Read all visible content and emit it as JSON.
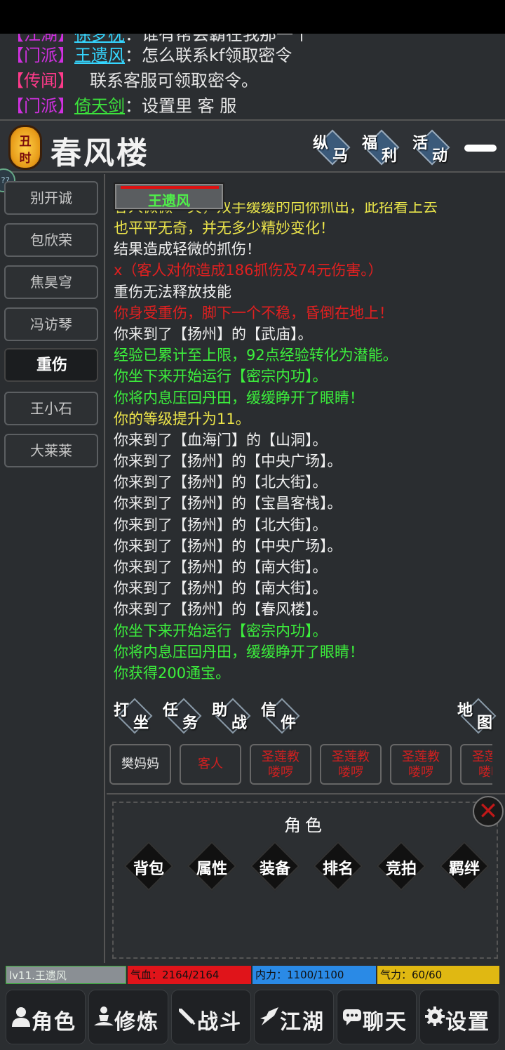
{
  "chat": {
    "lines": [
      {
        "tag": "【江湖】",
        "name": "徐梦枕",
        "text": "：谁有帮会霸在我那一个"
      },
      {
        "tag": "【门派】",
        "name": "王遗风",
        "text": "：怎么联系kf领取密令"
      },
      {
        "tag": "【传闻】",
        "name": "",
        "text": "联系客服可领取密令。"
      },
      {
        "tag": "【门派】",
        "name": "倚天剑",
        "text": "：设置里 客 服"
      }
    ]
  },
  "header": {
    "time_top": "丑",
    "time_bottom": "时",
    "location": "春风楼",
    "buttons": [
      {
        "c1": "纵",
        "c2": "马"
      },
      {
        "c1": "福",
        "c2": "利"
      },
      {
        "c1": "活",
        "c2": "动"
      }
    ]
  },
  "sidebar": {
    "help": "??",
    "npcs": [
      "别开诚",
      "包欣荣",
      "焦昊穹",
      "冯访琴",
      "",
      "王小石",
      "大莱莱"
    ],
    "status_popup": "重伤"
  },
  "target": {
    "name": "王遗风"
  },
  "log": {
    "clipped": "客人微微一笑，双手缓缓的向你抓出，此招看上去",
    "lines": [
      {
        "text": "也平平无奇，并无多少精妙变化！",
        "color": "yellow"
      },
      {
        "text": "结果造成轻微的抓伤！",
        "color": "white"
      },
      {
        "text": "x（客人对你造成186抓伤及74元伤害。）",
        "color": "red"
      },
      {
        "text": "重伤无法释放技能",
        "color": "white"
      },
      {
        "text": "你身受重伤，脚下一个不稳，昏倒在地上！",
        "color": "red"
      },
      {
        "text": "你来到了【扬州】的【武庙】。",
        "color": "white"
      },
      {
        "text": "经验已累计至上限，92点经验转化为潜能。",
        "color": "green"
      },
      {
        "text": "你坐下来开始运行【密宗内功】。",
        "color": "green"
      },
      {
        "text": "你将内息压回丹田，缓缓睁开了眼睛！",
        "color": "green"
      },
      {
        "text": "你的等级提升为11。",
        "color": "yellow"
      },
      {
        "text": "你来到了【血海门】的【山洞】。",
        "color": "white"
      },
      {
        "text": "你来到了【扬州】的【中央广场】。",
        "color": "white"
      },
      {
        "text": "你来到了【扬州】的【北大街】。",
        "color": "white"
      },
      {
        "text": "你来到了【扬州】的【宝昌客栈】。",
        "color": "white"
      },
      {
        "text": "你来到了【扬州】的【北大街】。",
        "color": "white"
      },
      {
        "text": "你来到了【扬州】的【中央广场】。",
        "color": "white"
      },
      {
        "text": "你来到了【扬州】的【南大街】。",
        "color": "white"
      },
      {
        "text": "你来到了【扬州】的【南大街】。",
        "color": "white"
      },
      {
        "text": "你来到了【扬州】的【春风楼】。",
        "color": "white"
      },
      {
        "text": "你坐下来开始运行【密宗内功】。",
        "color": "green"
      },
      {
        "text": "你将内息压回丹田，缓缓睁开了眼睛！",
        "color": "green"
      },
      {
        "text": "你获得200通宝。",
        "color": "green"
      }
    ]
  },
  "actions": [
    {
      "c1": "打",
      "c2": "坐"
    },
    {
      "c1": "任",
      "c2": "务"
    },
    {
      "c1": "助",
      "c2": "战"
    },
    {
      "c1": "信",
      "c2": "件"
    },
    {
      "c1": "地",
      "c2": "图"
    }
  ],
  "people": [
    {
      "l1": "樊妈妈",
      "l2": "",
      "color": "white"
    },
    {
      "l1": "客人",
      "l2": "",
      "color": "red"
    },
    {
      "l1": "圣莲教",
      "l2": "喽啰",
      "color": "red"
    },
    {
      "l1": "圣莲教",
      "l2": "喽啰",
      "color": "red"
    },
    {
      "l1": "圣莲教",
      "l2": "喽啰",
      "color": "red"
    },
    {
      "l1": "圣莲教",
      "l2": "喽啰",
      "color": "red"
    }
  ],
  "panel": {
    "title": "角色",
    "buttons": [
      "背包",
      "属性",
      "装备",
      "排名",
      "竞拍",
      "羁绊"
    ]
  },
  "stats": {
    "level": "lv11.王遗风",
    "hp": "气血：2164/2164",
    "mp": "内力：1100/1100",
    "sp": "气力：60/60"
  },
  "nav": [
    {
      "label": "角色",
      "icon": "person-icon"
    },
    {
      "label": "修炼",
      "icon": "meditate-icon"
    },
    {
      "label": "战斗",
      "icon": "sword-icon"
    },
    {
      "label": "江湖",
      "icon": "flag-icon"
    },
    {
      "label": "聊天",
      "icon": "chat-icon"
    },
    {
      "label": "设置",
      "icon": "gear-icon"
    }
  ],
  "colors": {
    "background": "#2a2d30",
    "green": "#3cf03c",
    "yellow": "#ece44a",
    "red": "#e02020",
    "hp_bar": "#e0141a",
    "mp_bar": "#2a8ae6",
    "sp_bar": "#e0b812"
  }
}
